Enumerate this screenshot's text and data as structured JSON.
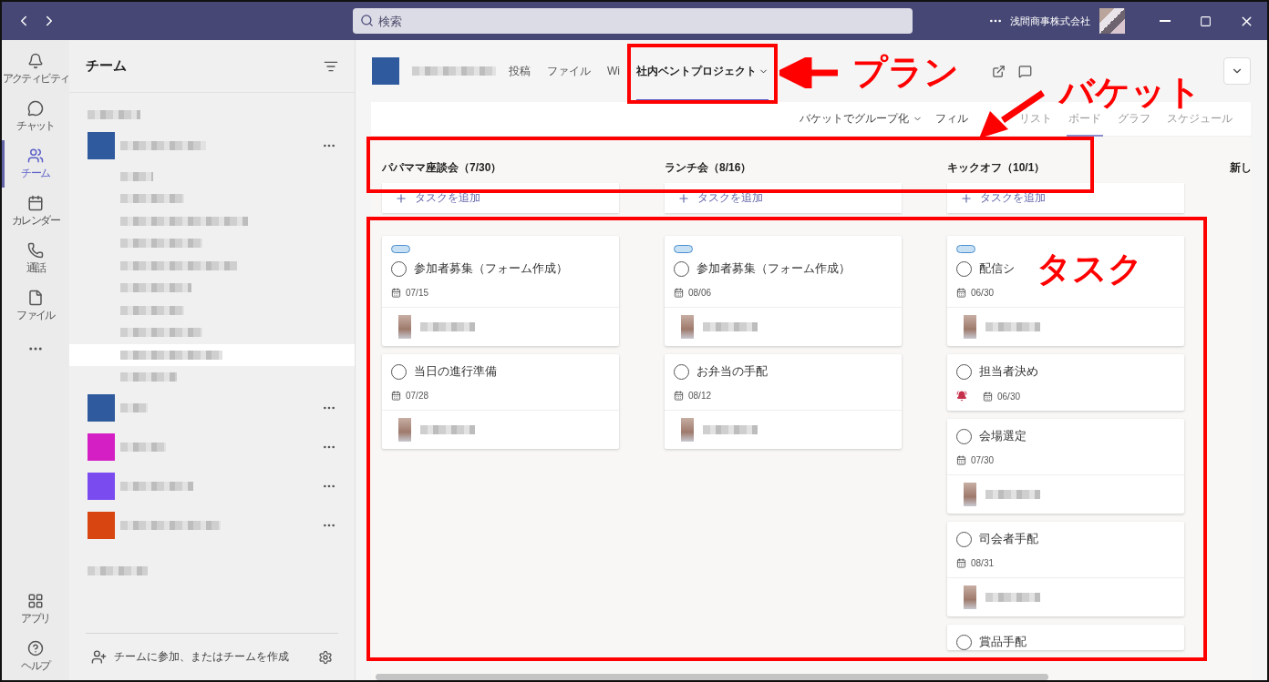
{
  "search": {
    "placeholder": "検索"
  },
  "org_name": "浅間商事株式会社",
  "rail": [
    {
      "label": "アクティビティ",
      "kind": "bell",
      "selected": false
    },
    {
      "label": "チャット",
      "kind": "chat",
      "selected": false
    },
    {
      "label": "チーム",
      "kind": "teams",
      "selected": true
    },
    {
      "label": "カレンダー",
      "kind": "calendar",
      "selected": false
    },
    {
      "label": "通話",
      "kind": "phone",
      "selected": false
    },
    {
      "label": "ファイル",
      "kind": "file",
      "selected": false
    },
    {
      "label": "アプリ",
      "kind": "apps",
      "selected": false
    },
    {
      "label": "ヘルプ",
      "kind": "help",
      "selected": false
    }
  ],
  "teams_panel": {
    "title": "チーム",
    "footer": "チームに参加、またはチームを作成",
    "teams": [
      {
        "color": "#2f5a9e",
        "channels": [
          {
            "selected": false
          },
          {
            "selected": false
          },
          {
            "selected": false
          },
          {
            "selected": false
          },
          {
            "selected": false
          },
          {
            "selected": false
          },
          {
            "selected": false
          },
          {
            "selected": false
          },
          {
            "selected": true
          },
          {
            "selected": false
          }
        ]
      },
      {
        "color": "#2f5a9e"
      },
      {
        "color": "#d41fc4"
      },
      {
        "color": "#7a4cf0"
      },
      {
        "color": "#d84510"
      }
    ]
  },
  "tabs": [
    {
      "label": "投稿",
      "selected": false
    },
    {
      "label": "ファイル",
      "selected": false
    },
    {
      "label": "Wi",
      "selected": false
    },
    {
      "label": "社内ベントプロジェクト",
      "selected": true
    }
  ],
  "toolbar": {
    "group_by": "バケットでグループ化",
    "filter": "フィル",
    "views": [
      {
        "label": "リスト",
        "selected": false
      },
      {
        "label": "ボード",
        "selected": true
      },
      {
        "label": "グラフ",
        "selected": false
      },
      {
        "label": "スケジュール",
        "selected": false
      }
    ]
  },
  "buckets": [
    {
      "title": "パパママ座談会（7/30）",
      "add_task": "タスクを追加",
      "tasks": [
        {
          "title": "参加者募集（フォーム作成）",
          "completed": false,
          "label": true,
          "urgent": false,
          "due": "07/15",
          "assigned": true
        },
        {
          "title": "当日の進行準備",
          "completed": false,
          "label": false,
          "urgent": false,
          "due": "07/28",
          "assigned": true
        }
      ]
    },
    {
      "title": "ランチ会（8/16）",
      "add_task": "タスクを追加",
      "tasks": [
        {
          "title": "参加者募集（フォーム作成）",
          "completed": false,
          "label": true,
          "urgent": false,
          "due": "08/06",
          "assigned": true
        },
        {
          "title": "お弁当の手配",
          "completed": false,
          "label": false,
          "urgent": false,
          "due": "08/12",
          "assigned": true
        }
      ]
    },
    {
      "title": "キックオフ（10/1）",
      "add_task": "タスクを追加",
      "tasks": [
        {
          "title": "配信シ",
          "completed": false,
          "label": true,
          "urgent": false,
          "due": "06/30",
          "assigned": true
        },
        {
          "title": "担当者決め",
          "completed": false,
          "label": false,
          "urgent": true,
          "due": "06/30",
          "assigned": false
        },
        {
          "title": "会場選定",
          "completed": false,
          "label": false,
          "urgent": false,
          "due": "07/30",
          "assigned": true
        },
        {
          "title": "司会者手配",
          "completed": false,
          "label": false,
          "urgent": false,
          "due": "08/31",
          "assigned": true
        },
        {
          "title": "賞品手配",
          "completed": false,
          "label": false,
          "urgent": false,
          "assigned": false
        }
      ]
    },
    {
      "title": "新し"
    }
  ],
  "annotations": [
    {
      "text": "プラン"
    },
    {
      "text": "バケット"
    },
    {
      "text": "タスク"
    }
  ]
}
